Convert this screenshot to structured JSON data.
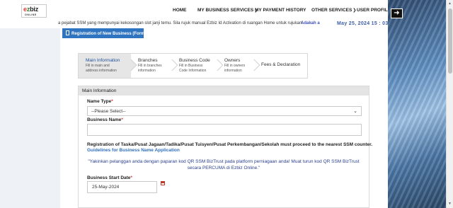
{
  "logo": {
    "e": "e",
    "z": "z",
    "biz": "biz",
    "tagline": "ONLINE"
  },
  "nav": {
    "home": "HOME",
    "my_business_services": "MY BUSINESS SERVICES",
    "my_payment_history": "MY PAYMENT HISTORY",
    "other_services": "OTHER SERVICES",
    "user_profile": "USER PROFILE"
  },
  "marquee": {
    "text": "a pejabat SSM yang mempunyai kekosongan slot janji temu. Sila rujuk manual Ezbiz Id Activation di ruangan Home untuk rujukan.",
    "text2": "Adakah a"
  },
  "datetime": "May 25, 2024 15 : 03 :",
  "form_tab": "Registration of New Business (FormA)",
  "steps": [
    {
      "title": "Main Information",
      "sub1": "Fill in main and",
      "sub2": "address information"
    },
    {
      "title": "Branches",
      "sub1": "Fill in branches",
      "sub2": "information"
    },
    {
      "title": "Business Code",
      "sub1": "Fill in Business",
      "sub2": "Code Information"
    },
    {
      "title": "Owners",
      "sub1": "Fill in owners",
      "sub2": "information"
    },
    {
      "title": "Fees & Declaration",
      "sub1": "",
      "sub2": ""
    }
  ],
  "section": {
    "title": "Main Information",
    "name_type_label": "Name Type",
    "name_type_value": "--Please Select--",
    "business_name_label": "Business Name",
    "business_name_value": "",
    "notice": "Registration of Taska/Pusat Jagaan/Tadika/Pusat Tuisyen/Pusat Perkembangan/Sekolah must proceed to the nearest SSM counter.",
    "guide_link": "Guidelines for Business Name Application",
    "promo_line1": "\"Yakinkan pelanggan anda dengan paparan kod QR SSM BizTrust pada platform perniagaan anda! Muat turun kod QR SSM BizTrust",
    "promo_line2": "secara  PERCUMA di Ezbiz Online.\"",
    "start_date_label": "Business Start Date",
    "start_date_value": "25-May-2024",
    "required_mark": "*"
  },
  "icons": {
    "logout": "logout-icon",
    "calendar": "calendar-icon",
    "form": "form-icon"
  }
}
